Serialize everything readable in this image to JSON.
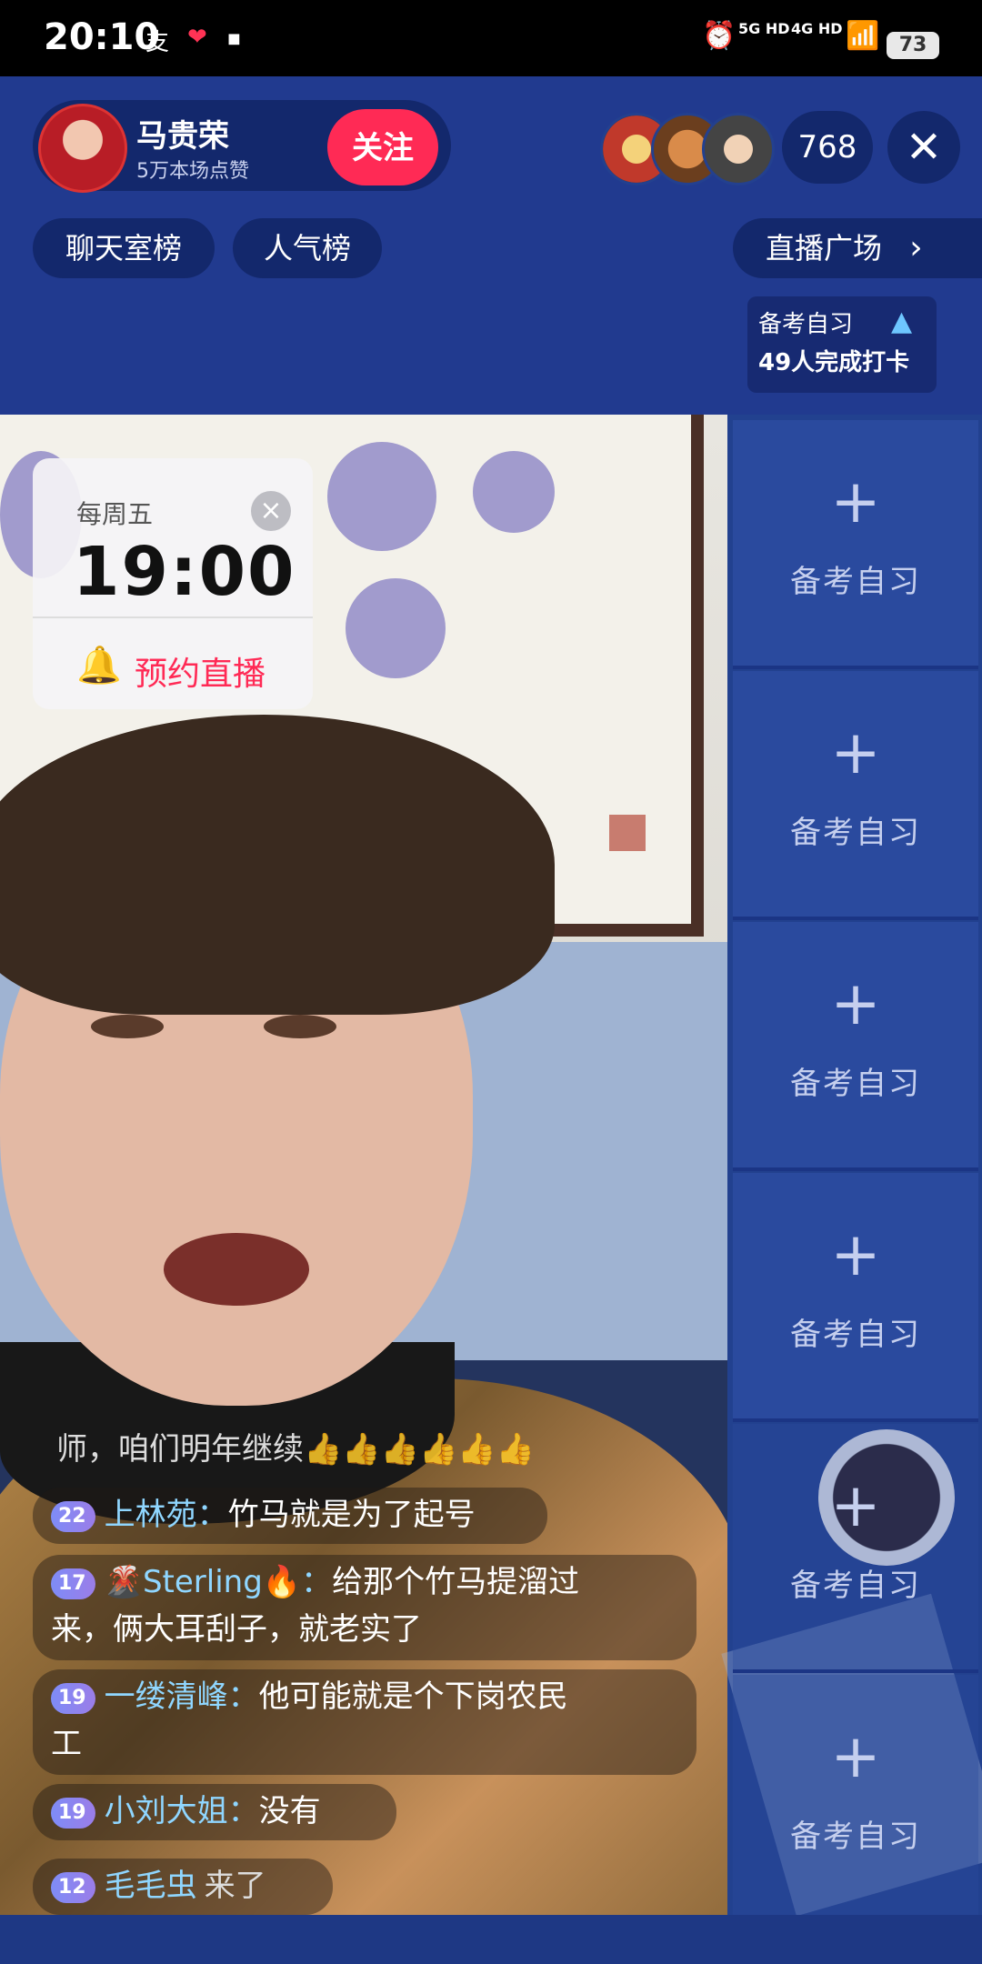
{
  "status_bar": {
    "time": "20:10",
    "net1": "5G HD",
    "net2": "4G HD",
    "battery": "73",
    "app_icons": [
      "alipay-icon",
      "app-heart-icon",
      "app-dashen-icon"
    ]
  },
  "anchor": {
    "name": "马贵荣",
    "likes": "5万本场点赞",
    "follow_label": "关注"
  },
  "viewers": {
    "count": "768"
  },
  "ranks": {
    "chat_rank": "聊天室榜",
    "popularity_rank": "人气榜",
    "plaza": "直播广场"
  },
  "checkin": {
    "title": "备考自习",
    "count": "49人完成打卡"
  },
  "schedule": {
    "day": "每周五",
    "time": "19:00",
    "remind_label": "预约直播"
  },
  "slots": [
    "备考自习",
    "备考自习",
    "备考自习",
    "备考自习",
    "备考自习",
    "备考自习"
  ],
  "chat": {
    "faded_line": "师，咱们明年继续👍👍👍👍👍👍",
    "messages": [
      {
        "level": "22",
        "user": "上林苑：",
        "text": "竹马就是为了起号",
        "cont": ""
      },
      {
        "level": "17",
        "user": "🌋Sterling🔥：",
        "text": "给那个竹马提溜过",
        "cont": "来，俩大耳刮子，就老实了"
      },
      {
        "level": "19",
        "user": "一缕清峰：",
        "text": "他可能就是个下岗农民",
        "cont": "工"
      },
      {
        "level": "19",
        "user": "小刘大姐：",
        "text": "没有",
        "cont": ""
      },
      {
        "level": "12",
        "user": "毛毛虫",
        "text": "来了",
        "cont": ""
      }
    ]
  },
  "colors": {
    "background": "#1f3b92",
    "follow": "#ff2a55",
    "username": "#8fd6ff"
  }
}
